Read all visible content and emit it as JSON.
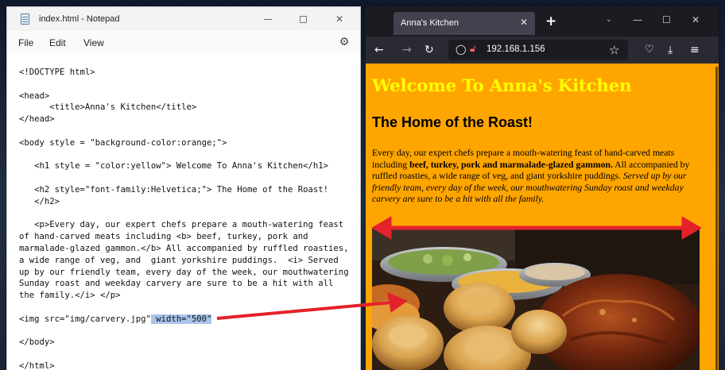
{
  "notepad": {
    "title": "index.html - Notepad",
    "menu": [
      "File",
      "Edit",
      "View"
    ],
    "code_lines": [
      "<!DOCTYPE html>",
      "",
      "<head>",
      "      <title>Anna's Kitchen</title>",
      "</head>",
      "",
      "<body style = \"background-color:orange;\">",
      "",
      "   <h1 style = \"color:yellow\"> Welcome To Anna's Kitchen</h1>",
      "",
      "   <h2 style=\"font-family:Helvetica;\"> The Home of the Roast!",
      "   </h2>",
      "",
      "   <p>Every day, our expert chefs prepare a mouth-watering feast",
      "of hand-carved meats including <b> beef, turkey, pork and",
      "marmalade-glazed gammon.</b> All accompanied by ruffled roasties,",
      "a wide range of veg, and  giant yorkshire puddings.  <i> Served",
      "up by our friendly team, every day of the week, our mouthwatering",
      "Sunday roast and weekday carvery are sure to be a hit with all",
      "the family.</i> </p>",
      "",
      "<img src=\"img/carvery.jpg\"",
      "",
      "</body>",
      "",
      "</html>"
    ],
    "img_line_selected_suffix": " width=\"500\""
  },
  "browser": {
    "tab_title": "Anna's Kitchen",
    "url": "192.168.1.156",
    "page": {
      "h1": "Welcome To Anna's Kitchen",
      "h2": "The Home of the Roast!",
      "para_part1": "Every day, our expert chefs prepare a mouth-watering feast of hand-carved meats including ",
      "para_bold": "beef, turkey, pork and marmalade-glazed gammon.",
      "para_part2": " All accompanied by ruffled roasties, a wide range of veg, and giant yorkshire puddings. ",
      "para_italic": "Served up by our friendly team, every day of the week, our mouthwatering Sunday roast and weekday carvery are sure to be a hit with all the family.",
      "background_color": "#ffa500",
      "h1_color": "#ffff00"
    }
  },
  "annotation": {
    "arrow_color": "#e4222a"
  }
}
